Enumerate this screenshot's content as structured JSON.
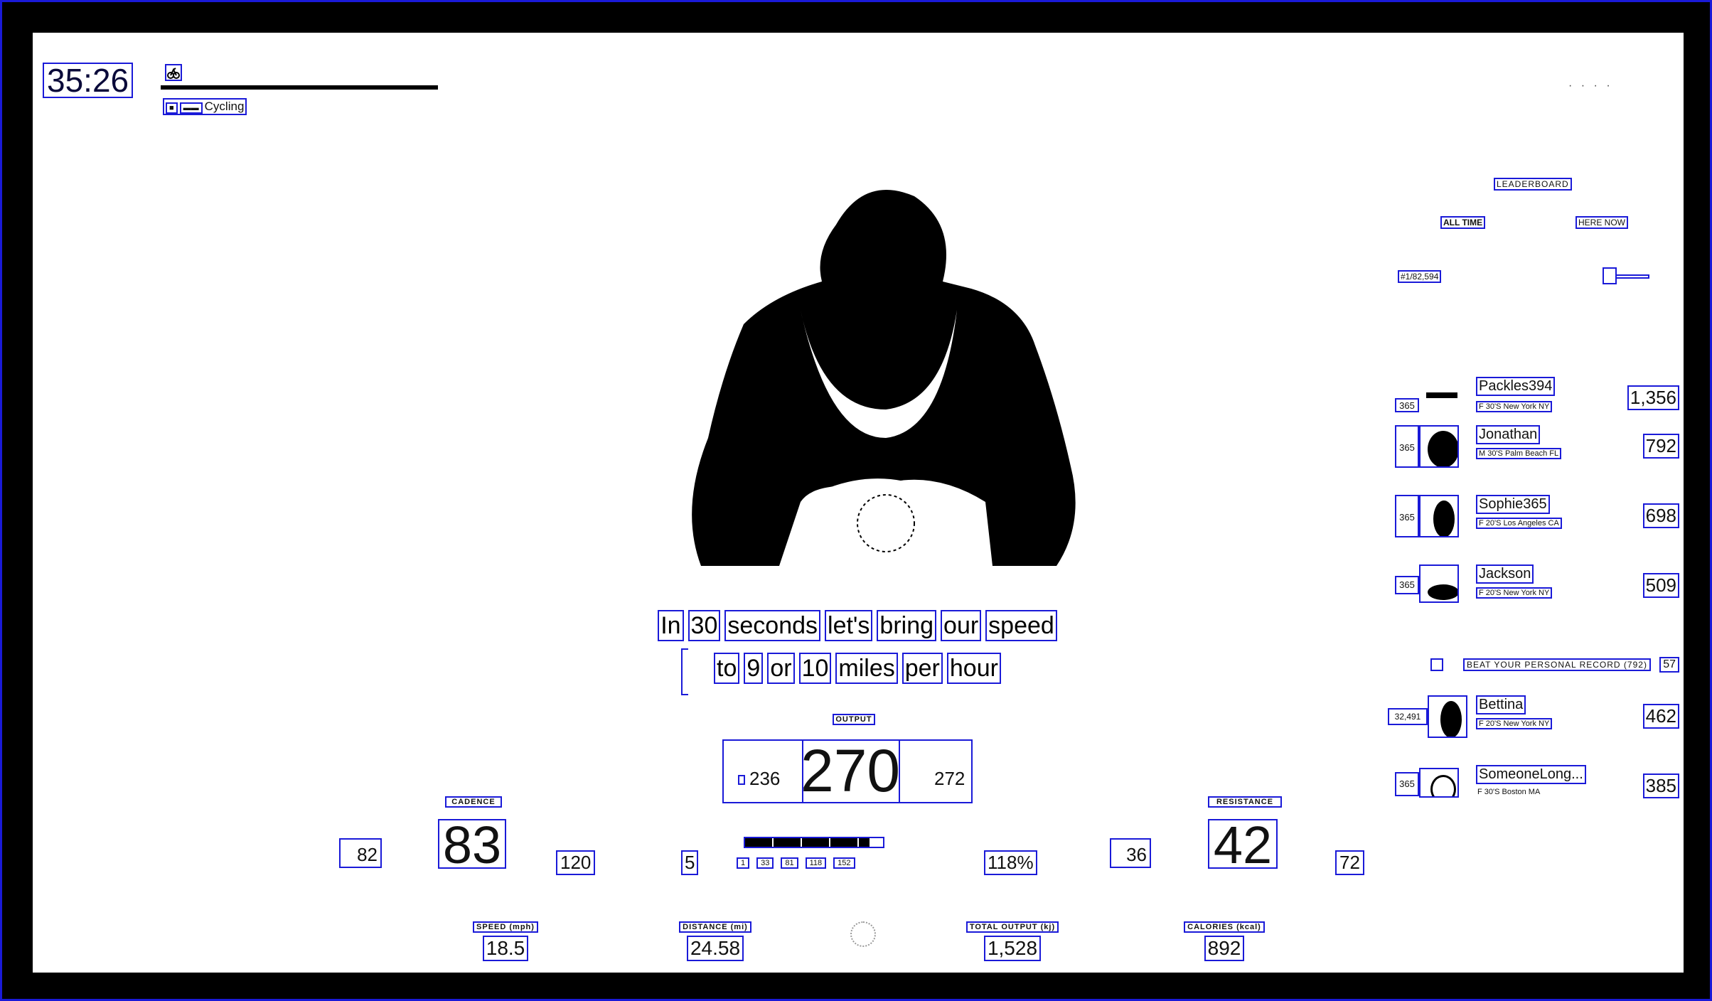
{
  "header": {
    "timer": "35:26",
    "class_icon": "bike-icon",
    "class_meta": {
      "tags": [
        "■",
        "▬▬"
      ],
      "label": "Cycling"
    },
    "top_right": "·  · · ·"
  },
  "caption": {
    "line1": [
      "In",
      "30",
      "seconds",
      "let's",
      "bring",
      "our",
      "speed"
    ],
    "line2": [
      "to",
      "9",
      "or",
      "10",
      "miles",
      "per",
      "hour"
    ]
  },
  "output": {
    "label": "OUTPUT",
    "min": "236",
    "value": "270",
    "max": "272"
  },
  "cadence": {
    "label": "CADENCE",
    "low": "82",
    "value": "83",
    "high": "120"
  },
  "resistance": {
    "label": "RESISTANCE",
    "low": "36",
    "value": "42",
    "high": "72"
  },
  "zone": {
    "number": "5",
    "fill_fraction": 0.9,
    "scale": [
      "1",
      "33",
      "81",
      "118",
      "152"
    ],
    "percent": "118%"
  },
  "metrics": [
    {
      "label": "SPEED (mph)",
      "value": "18.5"
    },
    {
      "label": "DISTANCE (mi)",
      "value": "24.58"
    },
    {
      "label": "TOTAL OUTPUT (kj)",
      "value": "1,528"
    },
    {
      "label": "CALORIES (kcal)",
      "value": "892"
    }
  ],
  "leaderboard": {
    "title": "LEADERBOARD",
    "tab_all": "ALL TIME",
    "tab_here": "HERE NOW",
    "count": "#1/82,594",
    "rows": [
      {
        "badge": "365",
        "name": "Packles394",
        "sub": "F 30'S New York NY",
        "score": "1,356"
      },
      {
        "badge": "365",
        "name": "Jonathan",
        "sub": "M 30'S Palm Beach FL",
        "score": "792"
      },
      {
        "badge": "365",
        "name": "Sophie365",
        "sub": "F 20'S Los Angeles CA",
        "score": "698"
      },
      {
        "badge": "365",
        "name": "Jackson",
        "sub": "F 20'S New York NY",
        "score": "509"
      },
      {
        "badge": "32,491",
        "name": "Bettina",
        "sub": "F 20'S New York NY",
        "score": "462"
      },
      {
        "badge": "365",
        "name": "SomeoneLong...",
        "sub": "F 30'S Boston MA",
        "score": "385"
      }
    ],
    "pr": {
      "text": "BEAT YOUR PERSONAL RECORD (792)",
      "score": "57"
    }
  }
}
